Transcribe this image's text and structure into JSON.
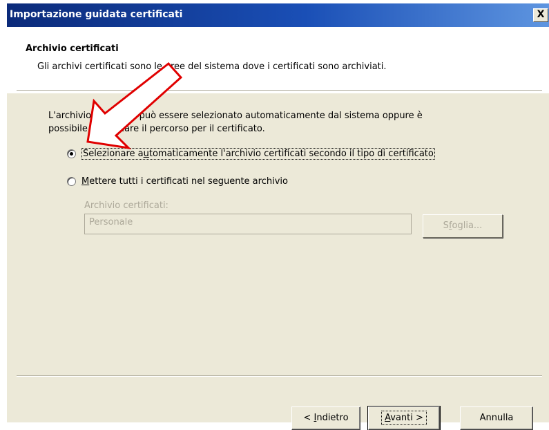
{
  "window": {
    "title": "Importazione guidata certificati",
    "close_label": "X"
  },
  "header": {
    "title": "Archivio certificati",
    "subtitle": "Gli archivi certificati sono le aree del sistema dove i certificati sono archiviati."
  },
  "body": {
    "description_line1": "L'archivio certificati può essere selezionato automaticamente dal sistema oppure è",
    "description_line2": "possibile specificare il percorso per il certificato.",
    "option_auto": {
      "label_pre": "Selezionare a",
      "label_u": "u",
      "label_post": "tomaticamente l'archivio certificati secondo il tipo di certificato",
      "selected": true
    },
    "option_manual": {
      "label_u": "M",
      "label_post": "ettere tutti i certificati nel seguente archivio",
      "selected": false
    },
    "store_label": "Archivio certificati:",
    "store_value": "Personale",
    "browse_pre": "S",
    "browse_u": "f",
    "browse_post": "oglia..."
  },
  "footer": {
    "back_pre": "< ",
    "back_u": "I",
    "back_post": "ndietro",
    "next_u": "A",
    "next_post": "vanti >",
    "cancel_label": "Annulla"
  },
  "colors": {
    "title_start": "#0b2a7a",
    "title_end": "#5e95e0",
    "dialog_bg": "#ece9d8",
    "arrow_outline": "#e00000"
  },
  "annotation": {
    "type": "arrow-icon",
    "color": "red-outline"
  }
}
